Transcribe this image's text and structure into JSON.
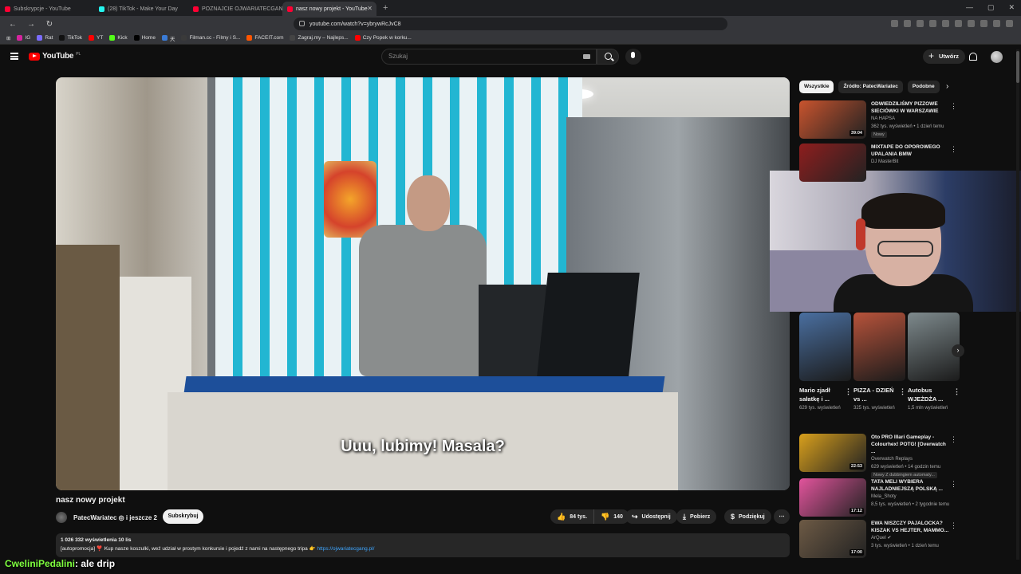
{
  "browser": {
    "tabs": [
      {
        "title": "Subskrypcje - YouTube",
        "color": "#ff0033",
        "active": false
      },
      {
        "title": "(28) TikTok - Make Your Day",
        "color": "#25f4ee",
        "active": false
      },
      {
        "title": "POZNAJCIE OJWARIATECGANG! - Yo",
        "color": "#ff0033",
        "active": false
      },
      {
        "title": "nasz nowy projekt - YouTube",
        "color": "#ff0033",
        "active": true
      }
    ],
    "url": "youtube.com/watch?v=ybrywRcJvC8",
    "bookmarks": [
      {
        "label": "IG",
        "color": "#d6249f"
      },
      {
        "label": "Rat",
        "color": "#7b6cff"
      },
      {
        "label": "TikTok",
        "color": "#111111"
      },
      {
        "label": "YT",
        "color": "#ff0000"
      },
      {
        "label": "Kick",
        "color": "#53fc18"
      },
      {
        "label": "Home",
        "color": "#000000"
      },
      {
        "label": "天",
        "color": "#3a7bd5"
      },
      {
        "label": "Filman.cc - Filmy i S...",
        "color": "#3a3a3a"
      },
      {
        "label": "FACEIT.com",
        "color": "#ff5500"
      },
      {
        "label": "Zagraj.my – Najleps...",
        "color": "#444444"
      },
      {
        "label": "Czy Popek w korku...",
        "color": "#ff0000"
      }
    ]
  },
  "header": {
    "logo_text": "YouTube",
    "logo_region": "PL",
    "search_placeholder": "Szukaj",
    "create_label": "Utwórz"
  },
  "video": {
    "subtitle": "Uuu, lubimy! Masala?",
    "title": "nasz nowy projekt",
    "channel": "PatecWariatec ◎ i jeszcze 2",
    "subscribe_label": "Subskrybuj",
    "likes": "84 tys.",
    "dislikes": "140",
    "share_label": "Udostępnij",
    "download_label": "Pobierz",
    "thanks_label": "Podziękuj",
    "more_label": "⋯"
  },
  "description": {
    "stats": "1 026 332 wyświetlenia  10 lis",
    "text": "[autopromocja] ❣️ Kup nasze koszulki, weź udział w prostym konkursie i pojedź z nami na następnego tripa 👉",
    "link": "https://ojwariatecgang.pl/"
  },
  "chat": {
    "name": "CweliniPedalini",
    "message": ": ale drip"
  },
  "sidebar": {
    "chips": [
      "Wszystkie",
      "Źródło: PatecWariatec",
      "Podobne"
    ],
    "recommended_top": [
      {
        "title": "ODWIEDZILIŚMY PIZZOWE SIECIÓWKI W WARSZAWIE",
        "channel": "NA HAPSA",
        "meta": "362 tys. wyświetleń • 1 dzień temu",
        "badge": "Nowy",
        "duration": "39:04",
        "bg": "#c9542e"
      },
      {
        "title": "MIXTAPE DO OPOROWEGO UPALANIA BMW",
        "channel": "DJ MasterBit",
        "meta": "",
        "badge": "",
        "duration": "",
        "bg": "#8e1e1e"
      }
    ],
    "shorts": [
      {
        "title": "Mario zjadł sałatkę i ...",
        "views": "629 tys. wyświetleń",
        "bg": "#4a6fa0"
      },
      {
        "title": "PIZZA - DZIEŃ vs ...",
        "views": "325 tys. wyświetleń",
        "bg": "#b7533b"
      },
      {
        "title": "Autobus WJEŻDŻA ...",
        "views": "1,5 mln wyświetleń",
        "bg": "#7e8a8d"
      }
    ],
    "recommended_bottom": [
      {
        "title": "Oto PRO Illari Gameplay - Colourhex! POTG! [Overwatch ...",
        "channel": "Overwatch Replays",
        "meta": "629 wyświetleń • 14 godzin temu",
        "badge": "Nowy  Z dubbingiem automaty...",
        "duration": "22:53",
        "bg": "#d9a01c"
      },
      {
        "title": "TATA MELI WYBIERA NAJLADNIEJSZĄ POLSKĄ ...",
        "channel": "Mela_Shoty",
        "meta": "8,5 tys. wyświetleń • 2 tygodnie temu",
        "badge": "",
        "duration": "17:12",
        "bg": "#e2549c"
      },
      {
        "title": "EWA NISZCZY PAJALOCKA? KISZAK VS HEJTER, MAMMO...",
        "channel": "ArQuel ✔",
        "meta": "3 tys. wyświetleń • 1 dzień temu",
        "badge": "",
        "duration": "17:00",
        "bg": "#6d5a45"
      }
    ]
  }
}
